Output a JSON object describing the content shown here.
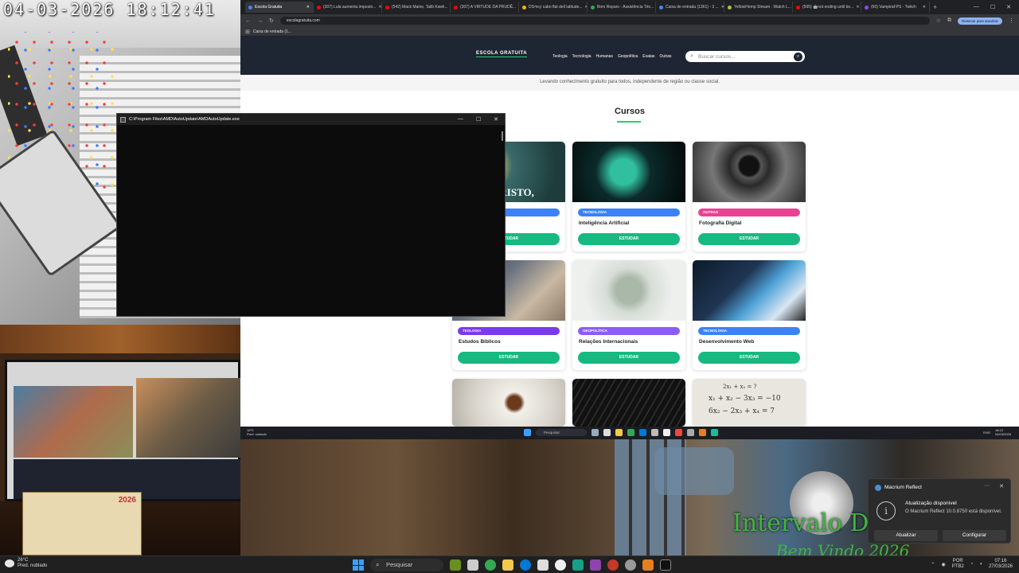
{
  "camera_overlay": {
    "timestamp": "04-03-2026  18:12:41",
    "calendar_label": "2026"
  },
  "browser": {
    "tabs": [
      {
        "label": "Escola Gratuita",
        "color": "#4285f4",
        "active": true
      },
      {
        "label": "(307) Lula aumenta imposto...",
        "color": "#ff0000"
      },
      {
        "label": "(542) Mack Maine, Talib Kweli...",
        "color": "#ff0000"
      },
      {
        "label": "(307) A VIRTUDE DA PRUDÊ...",
        "color": "#ff0000"
      },
      {
        "label": "DS²ncy cabo flat dell latitude...",
        "color": "#f4b400"
      },
      {
        "label": "Bom Reparo - Assistência Téc...",
        "color": "#34a853"
      },
      {
        "label": "Caixa de entrada (1361) - 3 ...",
        "color": "#4285f4"
      },
      {
        "label": "YellowHemp Stream - Watch L...",
        "color": "#9acd32"
      },
      {
        "label": "(565) 🤖not ending until bo...",
        "color": "#ff0000"
      },
      {
        "label": "(60) VampiraFPS - Twitch",
        "color": "#9146ff"
      }
    ],
    "url": "escolagratuita.com",
    "update_button": "Reiniciar para atualizar",
    "bookmarks": [
      "Caixa de entrada (1..."
    ]
  },
  "site": {
    "logo": "ESCOLA GRATUITA",
    "nav": [
      "Teologia",
      "Tecnologia",
      "Humanas",
      "Geopolítica",
      "Exatas",
      "Outras"
    ],
    "search_placeholder": "Buscar cursos...",
    "tagline": "Levando conhecimento gratuito para todos, independente de região ou classe social.",
    "section_title": "Cursos",
    "cards": [
      {
        "badge": "",
        "title": "",
        "button": "ESTUDAR",
        "badge_color": "#3b82f6",
        "image_text": "CRISTO,"
      },
      {
        "badge": "TECNOLOGIA",
        "title": "Inteligência Artificial",
        "button": "ESTUDAR",
        "badge_color": "#3b82f6"
      },
      {
        "badge": "OUTRAS",
        "title": "Fotografia Digital",
        "button": "ESTUDAR",
        "badge_color": "#e84393"
      },
      {
        "badge": "TEOLOGIA",
        "title": "Estudos Bíblicos",
        "button": "ESTUDAR",
        "badge_color": "#7c3aed"
      },
      {
        "badge": "GEOPOLÍTICA",
        "title": "Relações Internacionais",
        "button": "ESTUDAR",
        "badge_color": "#8b5cf6"
      },
      {
        "badge": "TECNOLOGIA",
        "title": "Desenvolvimento Web",
        "button": "ESTUDAR",
        "badge_color": "#3b82f6"
      }
    ],
    "math_text": [
      "2x₁ + x₂ = ?",
      "x₁ + x₂ − 3x₃ = −10",
      "6x₂ − 2x₃ + x₄ = 7"
    ]
  },
  "console": {
    "title": "C:\\Program Files\\AMD\\AutoUpdate\\AMDAutoUpdate.exe"
  },
  "inner_taskbar": {
    "weather": "18°C",
    "weather_sub": "Pred. nublado",
    "search": "Pesquisar",
    "lang": "ENG",
    "time": "18:12",
    "date": "04/03/2026"
  },
  "notification": {
    "app": "Macrium Reflect",
    "heading": "Atualização disponível",
    "body": "O Macrium Reflect 10.0.8750 está disponível.",
    "button_update": "Atualizar",
    "button_configure": "Configurar"
  },
  "overlay": {
    "line1": "Intervalo De",
    "line2": "Bem Vindo 2026"
  },
  "taskbar": {
    "weather_temp": "26°C",
    "weather_desc": "Pred. nublado",
    "search": "Pesquisar",
    "lang_top": "POR",
    "lang_bottom": "PTB2",
    "time": "07:16",
    "date": "27/03/2026"
  }
}
